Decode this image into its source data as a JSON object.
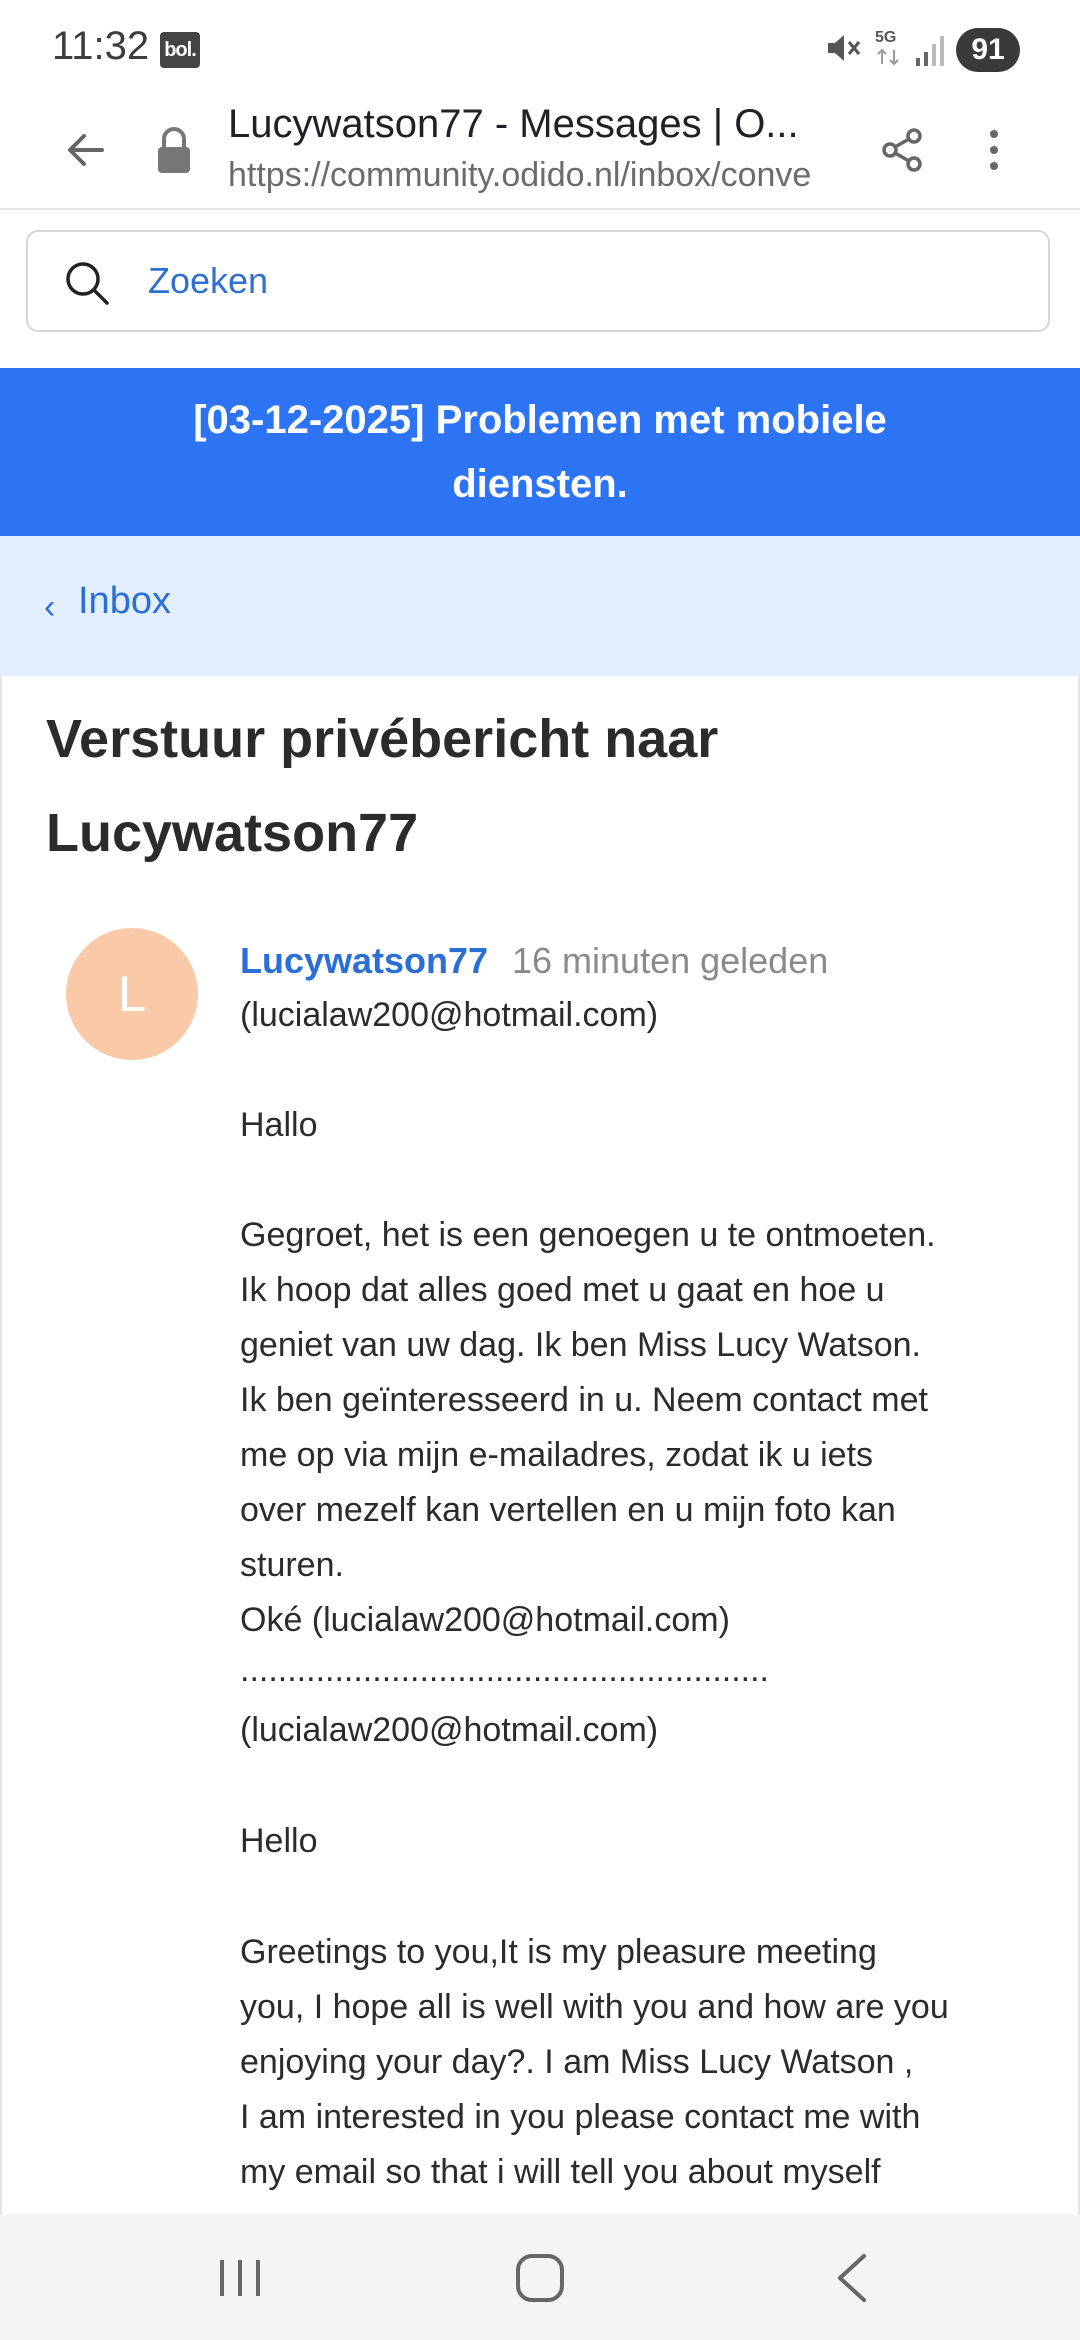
{
  "status_bar": {
    "time": "11:32",
    "app_badge": "bol.",
    "network": "5G",
    "battery": "91",
    "icons": [
      "mute-icon",
      "signal-icon"
    ]
  },
  "browser": {
    "title": "Lucywatson77 - Messages | O...",
    "url": "https://community.odido.nl/inbox/conve",
    "icons": [
      "back-arrow-icon",
      "lock-icon",
      "share-icon",
      "more-vert-icon"
    ]
  },
  "search": {
    "placeholder": "Zoeken"
  },
  "banner": {
    "text": "[03-12-2025] Problemen met mobiele diensten.",
    "color": "#2d74f5"
  },
  "breadcrumb": {
    "chevron": "‹",
    "label": "Inbox"
  },
  "page": {
    "heading_line1": "Verstuur privébericht naar",
    "heading_line2": "Lucywatson77"
  },
  "message": {
    "avatar_letter": "L",
    "avatar_color": "#f9c9a8",
    "sender": "Lucywatson77",
    "timestamp": "16 minuten geleden",
    "lines": [
      "(lucialaw200@hotmail.com)",
      "Hallo",
      "Gegroet, het is een genoegen u te ontmoeten.",
      "Ik hoop dat alles goed met u gaat en hoe u",
      "geniet van uw dag. Ik ben Miss Lucy Watson.",
      "Ik ben geïnteresseerd in u. Neem contact met",
      "me op via mijn e-mailadres, zodat ik u iets",
      "over mezelf kan vertellen en u mijn foto kan",
      "sturen.",
      "Oké (lucialaw200@hotmail.com)",
      "........................................................",
      "(lucialaw200@hotmail.com)",
      "Hello",
      "Greetings to you,It is my pleasure meeting",
      "you, I hope all is well with you and how are you",
      "enjoying your day?. I am Miss Lucy Watson ,",
      "I am interested in you please contact me with",
      "my email so that i will tell you about myself"
    ]
  },
  "nav": {
    "icons": [
      "recents-icon",
      "home-icon",
      "back-icon"
    ]
  }
}
